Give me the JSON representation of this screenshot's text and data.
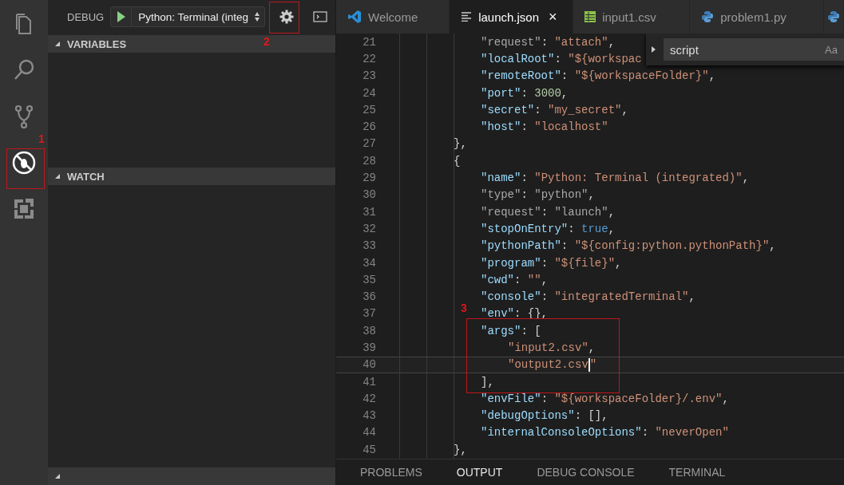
{
  "activity_bar": [
    {
      "kind": "files",
      "selected": false
    },
    {
      "kind": "search",
      "selected": false
    },
    {
      "kind": "source-control",
      "selected": false
    },
    {
      "kind": "debug",
      "selected": true
    },
    {
      "kind": "extensions",
      "selected": false
    }
  ],
  "sidebar": {
    "title": "DEBUG",
    "configuration": "Python: Terminal (integ",
    "sections": [
      {
        "title": "VARIABLES",
        "expanded": true
      },
      {
        "title": "WATCH",
        "expanded": true
      },
      {
        "expanded": true
      }
    ]
  },
  "tabs": [
    {
      "label": "Welcome",
      "kind": "welcome",
      "selected": false
    },
    {
      "label": "launch.json",
      "kind": "json",
      "selected": true,
      "close": "×"
    },
    {
      "label": "input1.csv",
      "kind": "csv",
      "selected": false
    },
    {
      "label": "problem1.py",
      "kind": "python",
      "selected": false
    },
    {
      "kind": "python",
      "selected": false
    }
  ],
  "find_widget": {
    "value": "script",
    "option": "Aa"
  },
  "code_lines": [
    {
      "number": "21",
      "current": false,
      "tokens": [
        {
          "kind": "dim",
          "text": "\"request\""
        },
        {
          "kind": "punct",
          "text": ": "
        },
        {
          "kind": "string",
          "text": "\"attach\""
        },
        {
          "kind": "punct",
          "text": ","
        }
      ]
    },
    {
      "number": "22",
      "current": false,
      "tokens": [
        {
          "kind": "key",
          "text": "\"localRoot\""
        },
        {
          "kind": "punct",
          "text": ": "
        },
        {
          "kind": "string",
          "text": "\"${workspac"
        }
      ]
    },
    {
      "number": "23",
      "current": false,
      "tokens": [
        {
          "kind": "key",
          "text": "\"remoteRoot\""
        },
        {
          "kind": "punct",
          "text": ": "
        },
        {
          "kind": "string",
          "text": "\"${workspaceFolder}\""
        },
        {
          "kind": "punct",
          "text": ","
        }
      ]
    },
    {
      "number": "24",
      "current": false,
      "tokens": [
        {
          "kind": "key",
          "text": "\"port\""
        },
        {
          "kind": "punct",
          "text": ": "
        },
        {
          "kind": "number",
          "text": "3000"
        },
        {
          "kind": "punct",
          "text": ","
        }
      ]
    },
    {
      "number": "25",
      "current": false,
      "tokens": [
        {
          "kind": "key",
          "text": "\"secret\""
        },
        {
          "kind": "punct",
          "text": ": "
        },
        {
          "kind": "string",
          "text": "\"my_secret\""
        },
        {
          "kind": "punct",
          "text": ","
        }
      ]
    },
    {
      "number": "26",
      "current": false,
      "tokens": [
        {
          "kind": "key",
          "text": "\"host\""
        },
        {
          "kind": "punct",
          "text": ": "
        },
        {
          "kind": "string",
          "text": "\"localhost\""
        }
      ]
    },
    {
      "number": "27",
      "current": false,
      "tokens": [
        {
          "kind": "punct",
          "text": "},"
        }
      ]
    },
    {
      "number": "28",
      "current": false,
      "tokens": [
        {
          "kind": "punct",
          "text": "{"
        }
      ]
    },
    {
      "number": "29",
      "current": false,
      "tokens": [
        {
          "kind": "key",
          "text": "\"name\""
        },
        {
          "kind": "punct",
          "text": ": "
        },
        {
          "kind": "string",
          "text": "\"Python: Terminal (integrated)\""
        },
        {
          "kind": "punct",
          "text": ","
        }
      ]
    },
    {
      "number": "30",
      "current": false,
      "tokens": [
        {
          "kind": "dim",
          "text": "\"type\""
        },
        {
          "kind": "punct",
          "text": ": "
        },
        {
          "kind": "dim",
          "text": "\"python\""
        },
        {
          "kind": "punct",
          "text": ","
        }
      ]
    },
    {
      "number": "31",
      "current": false,
      "tokens": [
        {
          "kind": "dim",
          "text": "\"request\""
        },
        {
          "kind": "punct",
          "text": ": "
        },
        {
          "kind": "dim",
          "text": "\"launch\""
        },
        {
          "kind": "punct",
          "text": ","
        }
      ]
    },
    {
      "number": "32",
      "current": false,
      "tokens": [
        {
          "kind": "key",
          "text": "\"stopOnEntry\""
        },
        {
          "kind": "punct",
          "text": ": "
        },
        {
          "kind": "bool",
          "text": "true"
        },
        {
          "kind": "punct",
          "text": ","
        }
      ]
    },
    {
      "number": "33",
      "current": false,
      "tokens": [
        {
          "kind": "key",
          "text": "\"pythonPath\""
        },
        {
          "kind": "punct",
          "text": ": "
        },
        {
          "kind": "string",
          "text": "\"${config:python.pythonPath}\""
        },
        {
          "kind": "punct",
          "text": ","
        }
      ]
    },
    {
      "number": "34",
      "current": false,
      "tokens": [
        {
          "kind": "key",
          "text": "\"program\""
        },
        {
          "kind": "punct",
          "text": ": "
        },
        {
          "kind": "string",
          "text": "\"${file}\""
        },
        {
          "kind": "punct",
          "text": ","
        }
      ]
    },
    {
      "number": "35",
      "current": false,
      "tokens": [
        {
          "kind": "key",
          "text": "\"cwd\""
        },
        {
          "kind": "punct",
          "text": ": "
        },
        {
          "kind": "string",
          "text": "\"\""
        },
        {
          "kind": "punct",
          "text": ","
        }
      ]
    },
    {
      "number": "36",
      "current": false,
      "tokens": [
        {
          "kind": "key",
          "text": "\"console\""
        },
        {
          "kind": "punct",
          "text": ": "
        },
        {
          "kind": "string",
          "text": "\"integratedTerminal\""
        },
        {
          "kind": "punct",
          "text": ","
        }
      ]
    },
    {
      "number": "37",
      "current": false,
      "tokens": [
        {
          "kind": "key",
          "text": "\"env\""
        },
        {
          "kind": "punct",
          "text": ": {},"
        }
      ]
    },
    {
      "number": "38",
      "current": false,
      "tokens": [
        {
          "kind": "key",
          "text": "\"args\""
        },
        {
          "kind": "punct",
          "text": ": ["
        }
      ]
    },
    {
      "number": "39",
      "current": false,
      "tokens": [
        {
          "kind": "string",
          "text": "\"input2.csv\""
        },
        {
          "kind": "punct",
          "text": ","
        }
      ]
    },
    {
      "number": "40",
      "current": true,
      "tokens": [
        {
          "kind": "string",
          "text": "\"output2.csv"
        },
        {
          "kind": "caret"
        },
        {
          "kind": "string",
          "text": "\""
        }
      ]
    },
    {
      "number": "41",
      "current": false,
      "tokens": [
        {
          "kind": "punct",
          "text": "],"
        }
      ]
    },
    {
      "number": "42",
      "current": false,
      "tokens": [
        {
          "kind": "key",
          "text": "\"envFile\""
        },
        {
          "kind": "punct",
          "text": ": "
        },
        {
          "kind": "string",
          "text": "\"${workspaceFolder}/.env\""
        },
        {
          "kind": "punct",
          "text": ","
        }
      ]
    },
    {
      "number": "43",
      "current": false,
      "tokens": [
        {
          "kind": "key",
          "text": "\"debugOptions\""
        },
        {
          "kind": "punct",
          "text": ": [],"
        }
      ]
    },
    {
      "number": "44",
      "current": false,
      "tokens": [
        {
          "kind": "key",
          "text": "\"internalConsoleOptions\""
        },
        {
          "kind": "punct",
          "text": ": "
        },
        {
          "kind": "string",
          "text": "\"neverOpen\""
        }
      ]
    },
    {
      "number": "45",
      "current": false,
      "tokens": [
        {
          "kind": "punct",
          "text": "},"
        }
      ]
    }
  ],
  "panel_tabs": [
    {
      "label": "PROBLEMS",
      "selected": false
    },
    {
      "label": "OUTPUT",
      "selected": true
    },
    {
      "label": "DEBUG CONSOLE",
      "selected": false
    },
    {
      "label": "TERMINAL",
      "selected": false
    }
  ],
  "annotations": [
    {
      "label": "1"
    },
    {
      "label": "2"
    },
    {
      "label": "3"
    }
  ]
}
